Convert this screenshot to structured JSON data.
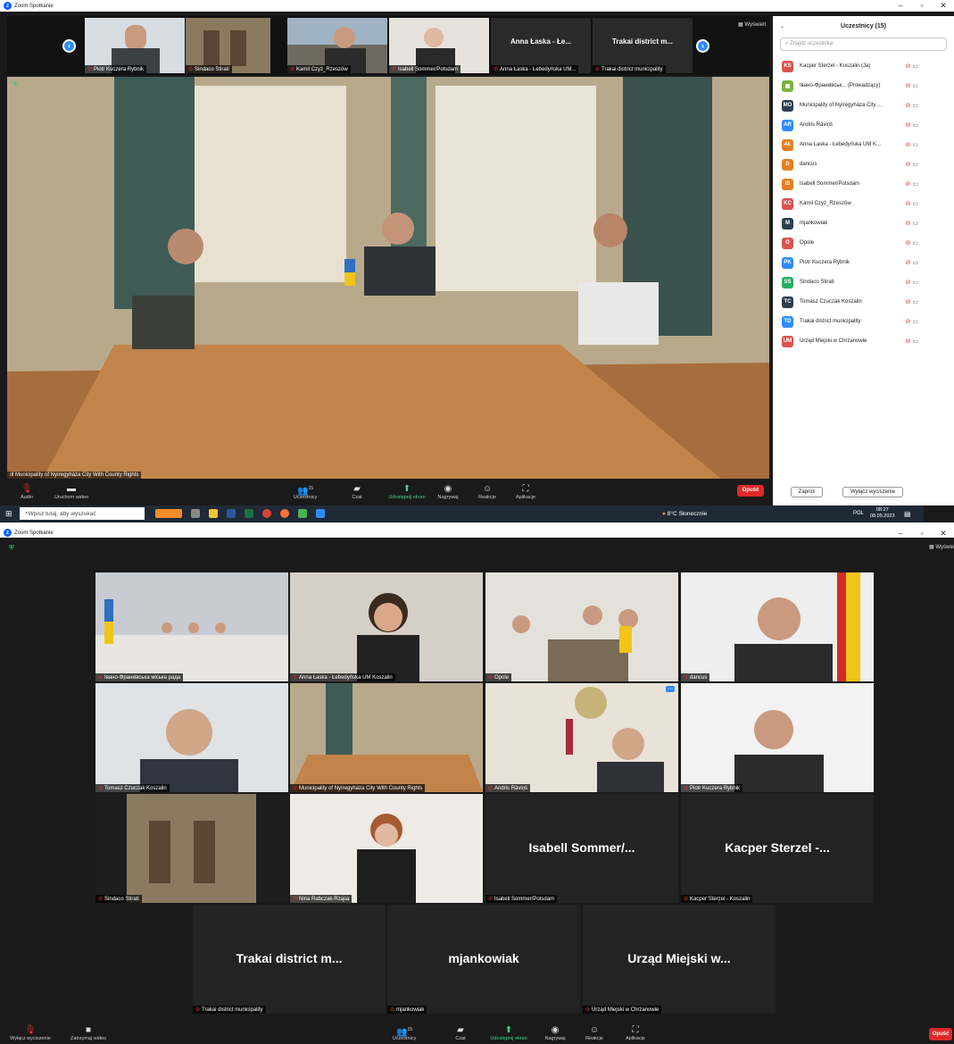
{
  "top": {
    "title": "Zoom Spotkanie",
    "view_label": "Wyświetl",
    "nav_prev": "‹",
    "nav_next": "›",
    "thumbnails": [
      {
        "name": "Piotr Kuczera Rybnik"
      },
      {
        "name": "Sindaco Stirati"
      },
      {
        "name": "Kamil Czyż_Rzeszów"
      },
      {
        "name": "Isabell Sommer/Potsdam"
      },
      {
        "name": "Anna Łaska - Łebedyńska UM...",
        "big": "Anna Łaska - Łe..."
      },
      {
        "name": "Trakai district municipality",
        "big": "Trakai district m..."
      }
    ],
    "main_video_label": "Municipality of Nyíregyháza City With County Rights",
    "toolbar": {
      "audio": "Audio",
      "video": "Uruchom wideo",
      "participants": "Uczestnicy",
      "participants_count": "15",
      "chat": "Czat",
      "share": "Udostępnij ekran",
      "record": "Nagrywaj",
      "reactions": "Reakcje",
      "apps": "Aplikacje",
      "leave": "Opuść"
    },
    "panel": {
      "title": "Uczestnicy (15)",
      "search_placeholder": "Znajdź uczestnika",
      "invite": "Zaproś",
      "mute_all": "Wyłącz wyciszenie",
      "participants": [
        {
          "initials": "KS",
          "name": "Kacper Sterzel - Koszalin (Ja)",
          "color": "#d9534f"
        },
        {
          "initials": "",
          "name": "Івано-Франківськ... (Prowadzący)",
          "color": "#7cb342"
        },
        {
          "initials": "MO",
          "name": "Municipality of Nyíregyháza City ...",
          "color": "#2c3e50"
        },
        {
          "initials": "AR",
          "name": "Andris Rāviņš",
          "color": "#2d8cff"
        },
        {
          "initials": "AŁ",
          "name": "Anna Łaska - Łebedyńska UM K...",
          "color": "#e67e22"
        },
        {
          "initials": "D",
          "name": "dancus",
          "color": "#e67e22"
        },
        {
          "initials": "IS",
          "name": "Isabell Sommer/Potsdam",
          "color": "#e67e22"
        },
        {
          "initials": "KC",
          "name": "Kamil Czyż_Rzeszów",
          "color": "#d9534f"
        },
        {
          "initials": "M",
          "name": "mjankowiak",
          "color": "#2c3e50"
        },
        {
          "initials": "O",
          "name": "Opole",
          "color": "#d9534f"
        },
        {
          "initials": "PK",
          "name": "Piotr Kuczera Rybnik",
          "color": "#2d8cff"
        },
        {
          "initials": "SS",
          "name": "Sindaco Stirati",
          "color": "#27ae60"
        },
        {
          "initials": "TC",
          "name": "Tomasz Czuczak Koszalin",
          "color": "#2c3e50"
        },
        {
          "initials": "TD",
          "name": "Trakai district municipality",
          "color": "#2d8cff"
        },
        {
          "initials": "UM",
          "name": "Urząd Miejski w Chrzanowie",
          "color": "#d9534f"
        }
      ]
    },
    "taskbar": {
      "search": "Wpisz tutaj, aby wyszukać",
      "weather": "8°C Słonecznie",
      "lang": "POL",
      "time": "08:27",
      "date": "08.05.2023"
    }
  },
  "bottom": {
    "title": "Zoom Spotkanie",
    "view_label": "Wyświe",
    "tiles": [
      {
        "name": "Івано-Франківська міська рада"
      },
      {
        "name": "Anna Łaska - Łebedyńska UM Koszalin"
      },
      {
        "name": "Opole"
      },
      {
        "name": "dancus"
      },
      {
        "name": "Tomasz Czuczak Koszalin"
      },
      {
        "name": "Municipality of Nyíregyháza City With County Rights"
      },
      {
        "name": "Andris Rāviņš"
      },
      {
        "name": "Piotr Kuczera Rybnik"
      },
      {
        "name": "Sindaco Stirati"
      },
      {
        "name": "Nina Rabczak-Rząsa"
      },
      {
        "name": "Isabell Sommer/Potsdam",
        "big": "Isabell Sommer/..."
      },
      {
        "name": "Kacper Sterzel - Koszalin",
        "big": "Kacper Sterzel -..."
      },
      {
        "name": "Trakai district municipality",
        "big": "Trakai district m..."
      },
      {
        "name": "mjankowiak",
        "big": "mjankowiak"
      },
      {
        "name": "Urząd Miejski w Chrzanowie",
        "big": "Urząd Miejski w..."
      }
    ],
    "toolbar": {
      "audio": "Wyłącz wyciszenie",
      "video": "Zatrzymaj wideo",
      "participants": "Uczestnicy",
      "participants_count": "15",
      "chat": "Czat",
      "share": "Udostępnij ekran",
      "record": "Nagrywaj",
      "reactions": "Reakcje",
      "apps": "Aplikacje",
      "leave": "Opuść"
    }
  }
}
